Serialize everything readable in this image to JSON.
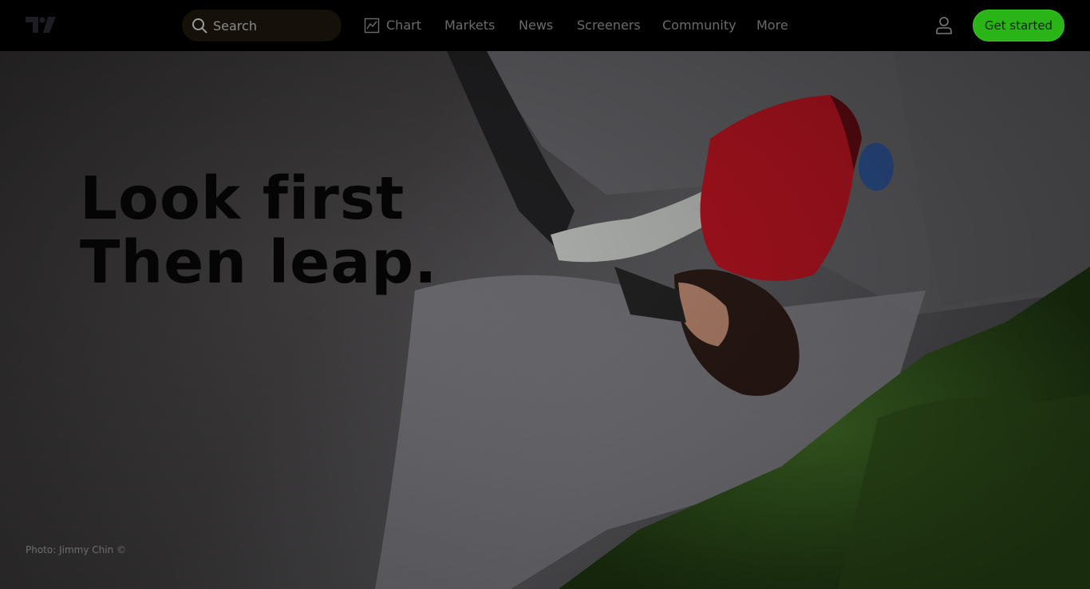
{
  "header": {
    "logo_icon": "tradingview-logo-icon",
    "search": {
      "label": "Search",
      "icon": "search-icon"
    },
    "nav": {
      "chart": {
        "label": "Chart",
        "icon": "chart-icon"
      },
      "markets": "Markets",
      "news": "News",
      "screeners": "Screeners",
      "community": "Community",
      "more": "More"
    },
    "user_icon": "user-icon",
    "cta_label": "Get started"
  },
  "hero": {
    "headline_line1": "Look first",
    "headline_line2": "Then leap.",
    "photo_credit": "Photo: Jimmy Chin ©"
  },
  "colors": {
    "header_bg": "#000000",
    "cta_bg": "#2bb418",
    "nav_text": "#6b6b6b",
    "headline": "#050505"
  }
}
